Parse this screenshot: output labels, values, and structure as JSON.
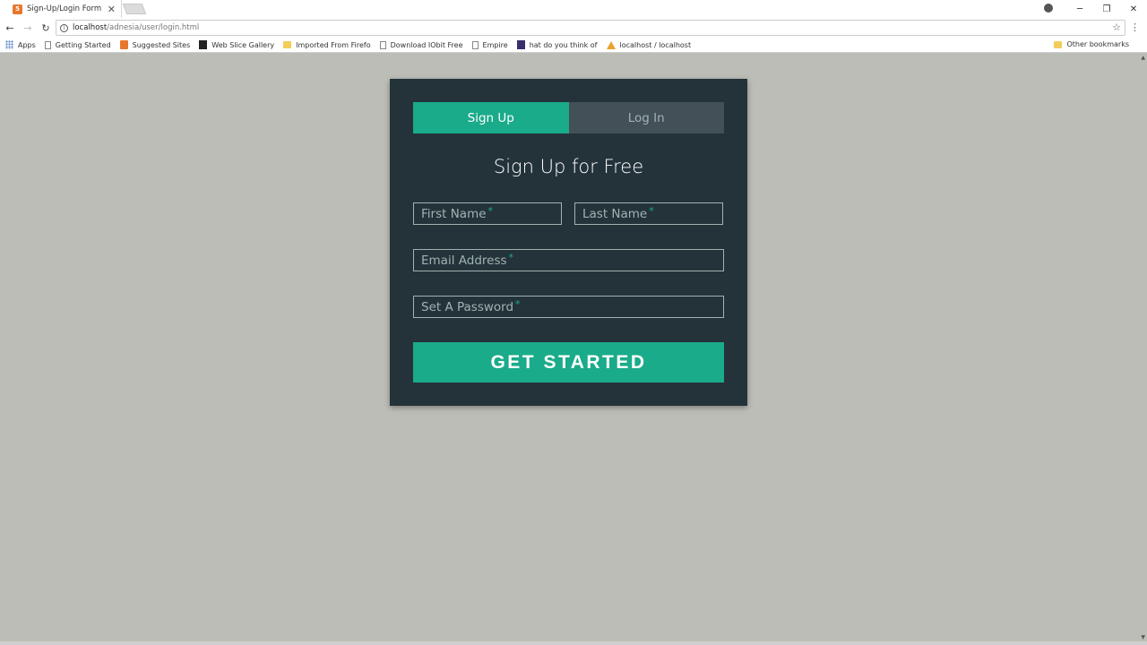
{
  "browser": {
    "tab_title": "Sign-Up/Login Form",
    "url_host": "localhost",
    "url_path": "/adnesia/user/login.html",
    "bookmarks": [
      {
        "label": "Apps",
        "icon": "apps-icon"
      },
      {
        "label": "Getting Started",
        "icon": "page-icon"
      },
      {
        "label": "Suggested Sites",
        "icon": "suggested-sites-icon"
      },
      {
        "label": "Web Slice Gallery",
        "icon": "web-slice-icon"
      },
      {
        "label": "Imported From Firefo",
        "icon": "folder-icon"
      },
      {
        "label": "Download IObit Free",
        "icon": "page-icon"
      },
      {
        "label": "Empire",
        "icon": "page-icon"
      },
      {
        "label": "hat do you think of",
        "icon": "site-icon"
      },
      {
        "label": "localhost / localhost",
        "icon": "phpmyadmin-icon"
      }
    ],
    "other_bookmarks": "Other bookmarks"
  },
  "form": {
    "tabs": [
      "Sign Up",
      "Log In"
    ],
    "active_tab": "Sign Up",
    "heading": "Sign Up for Free",
    "fields": {
      "first_name": "First Name",
      "last_name": "Last Name",
      "email": "Email Address",
      "password": "Set A Password"
    },
    "required_marker": "*",
    "submit": "GET STARTED"
  },
  "colors": {
    "accent": "#1aab8a",
    "card": "#24333a",
    "inactive_tab": "#435058",
    "page_bg": "#bdbdb7"
  }
}
